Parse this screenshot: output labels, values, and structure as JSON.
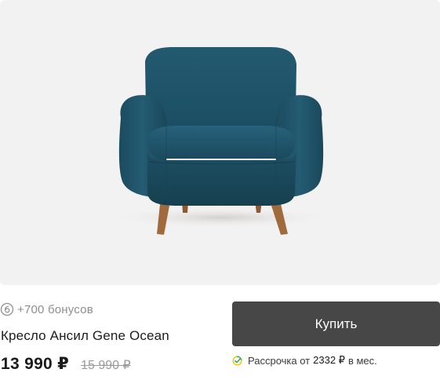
{
  "product": {
    "image_alt": "Кресло Ансил Gene Ocean",
    "bonus_text": "+700 бонусов",
    "title": "Кресло Ансил Gene Ocean",
    "price": "13 990 ₽",
    "old_price": "15 990 ₽",
    "chair_color": "#1d4d62"
  },
  "actions": {
    "buy_label": "Купить"
  },
  "installment": {
    "prefix": "Рассрочка от",
    "amount": "2332 ₽",
    "suffix": "в мес."
  },
  "icons": {
    "bonus": "bonus-coin-icon",
    "installment": "installment-check-icon"
  }
}
